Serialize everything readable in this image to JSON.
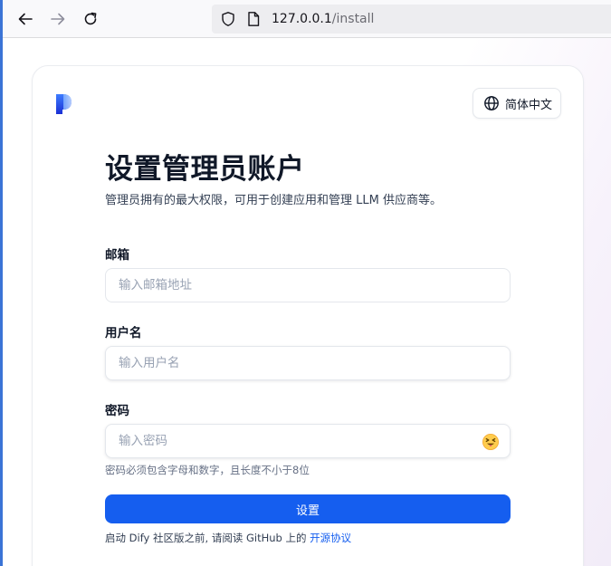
{
  "browser": {
    "url_host": "127.0.0.1",
    "url_path": "/install"
  },
  "header": {
    "language_label": "简体中文"
  },
  "main": {
    "title": "设置管理员账户",
    "subtitle": "管理员拥有的最大权限，可用于创建应用和管理 LLM 供应商等。"
  },
  "form": {
    "email_label": "邮箱",
    "email_placeholder": "输入邮箱地址",
    "username_label": "用户名",
    "username_placeholder": "输入用户名",
    "password_label": "密码",
    "password_placeholder": "输入密码",
    "password_hint": "密码必须包含字母和数字，且长度不小于8位",
    "submit_label": "设置"
  },
  "footer": {
    "text": "启动 Dify 社区版之前, 请阅读 GitHub 上的 ",
    "link_text": "开源协议"
  },
  "colors": {
    "primary": "#155eef",
    "logo_gradient": [
      "#3d7cff",
      "#1a2fd4"
    ]
  },
  "icons": [
    "back-arrow-icon",
    "forward-arrow-icon",
    "reload-icon",
    "shield-icon",
    "page-icon",
    "logo-icon",
    "globe-icon",
    "emoji-icon"
  ]
}
